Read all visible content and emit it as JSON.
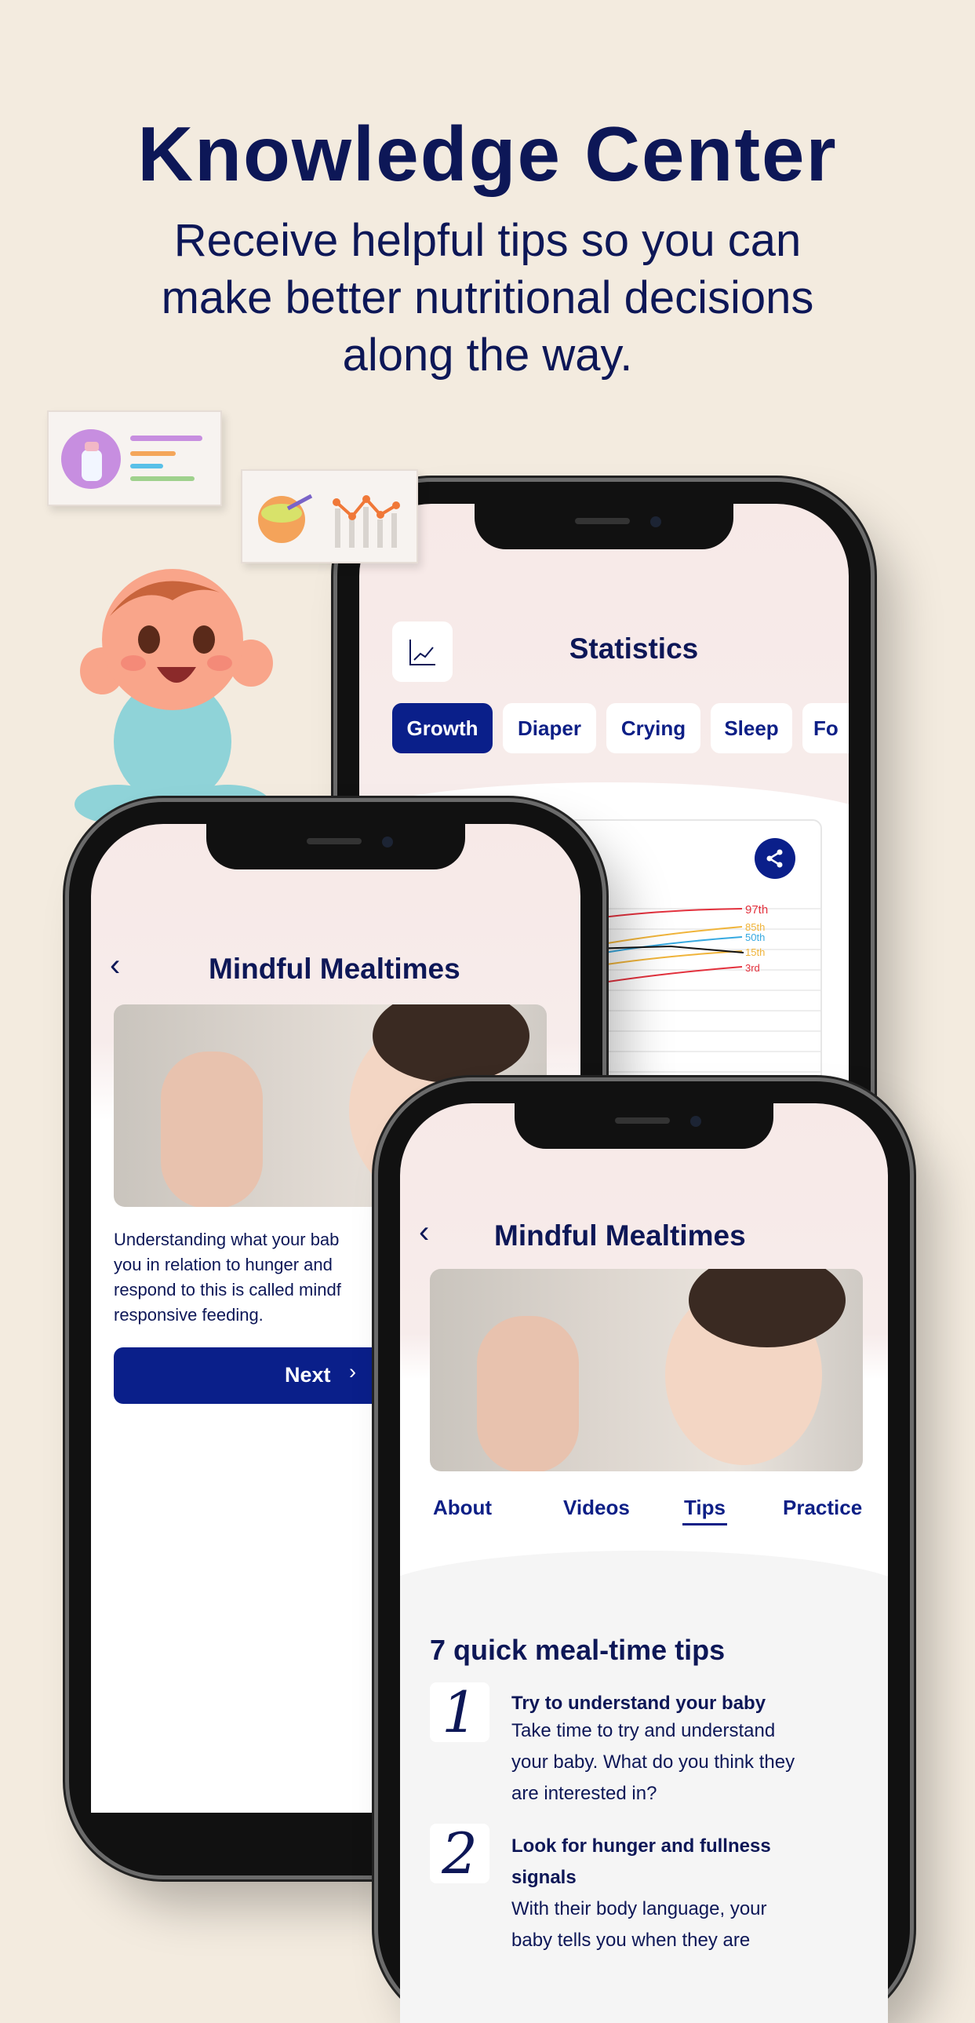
{
  "hero": {
    "title": "Knowledge Center",
    "subtitle_lines": [
      "Receive helpful tips so you can",
      "make better nutritional decisions",
      "along the way."
    ]
  },
  "statistics_screen": {
    "title": "Statistics",
    "header_icon": "line-chart-icon",
    "tabs": [
      {
        "label": "Growth",
        "selected": true
      },
      {
        "label": "Diaper"
      },
      {
        "label": "Crying"
      },
      {
        "label": "Sleep"
      },
      {
        "label": "Fo"
      }
    ],
    "share_icon": "share-icon",
    "percentiles": [
      {
        "label": "97th",
        "color": "#e3313d"
      },
      {
        "label": "85th",
        "color": "#f0b43a"
      },
      {
        "label": "50th",
        "color": "#37a9e0"
      },
      {
        "label": "15th",
        "color": "#f0b43a"
      },
      {
        "label": "3rd",
        "color": "#e3313d"
      }
    ]
  },
  "lesson_screen": {
    "title": "Mindful Mealtimes",
    "body_lines": [
      "Understanding what your bab",
      "you in relation to hunger and",
      "respond to this is called mindf",
      "responsive feeding."
    ],
    "next_label": "Next"
  },
  "tips_screen": {
    "title": "Mindful Mealtimes",
    "tabs": [
      {
        "label": "About"
      },
      {
        "label": "Videos"
      },
      {
        "label": "Tips",
        "selected": true
      },
      {
        "label": "Practice"
      }
    ],
    "section_title": "7 quick meal-time tips",
    "tips": [
      {
        "number": "1",
        "title": "Try to understand your baby",
        "desc_lines": [
          "Take time to try and understand",
          "your baby. What do you think they",
          "are interested in?"
        ]
      },
      {
        "number": "2",
        "title_lines": [
          "Look for hunger and fullness",
          "signals"
        ],
        "desc_lines": [
          "With their body language, your",
          "baby tells you when they are"
        ]
      }
    ]
  },
  "colors": {
    "navy": "#0d1757",
    "accent": "#0a1f8a",
    "background": "#f3ebdf"
  }
}
